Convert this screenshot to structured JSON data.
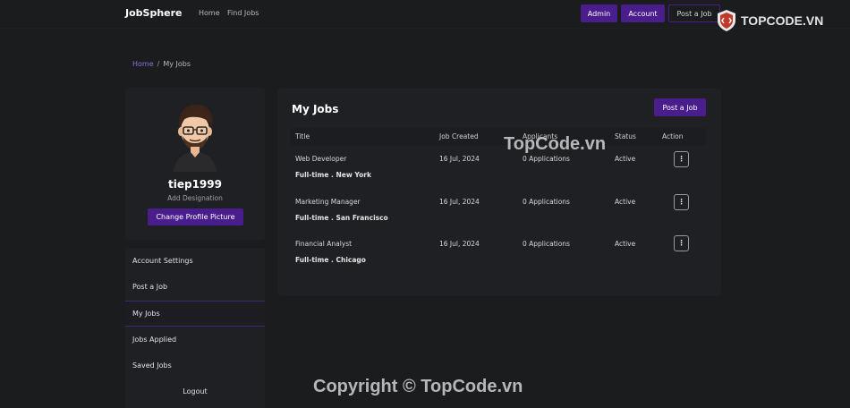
{
  "navbar": {
    "brand": "JobSphere",
    "links": [
      "Home",
      "Find Jobs"
    ],
    "admin_label": "Admin",
    "account_label": "Account",
    "post_job_label": "Post a Job"
  },
  "watermark": {
    "logo_text": "TOPCODE.VN",
    "center_text": "TopCode.vn",
    "bottom_text": "Copyright © TopCode.vn"
  },
  "breadcrumb": {
    "home": "Home",
    "separator": "/",
    "current": "My Jobs"
  },
  "profile": {
    "username": "tiep1999",
    "designation": "Add Designation",
    "change_picture_label": "Change Profile Picture"
  },
  "side_menu": {
    "items": [
      {
        "label": "Account Settings"
      },
      {
        "label": "Post a Job"
      },
      {
        "label": "My Jobs"
      },
      {
        "label": "Jobs Applied"
      },
      {
        "label": "Saved Jobs"
      },
      {
        "label": "Logout"
      }
    ],
    "active": "My Jobs"
  },
  "jobs_panel": {
    "title": "My Jobs",
    "post_job_label": "Post a Job",
    "columns": [
      "Title",
      "Job Created",
      "Applicants",
      "Status",
      "Action"
    ],
    "rows": [
      {
        "title": "Web Developer",
        "meta": "Full-time . New York",
        "created": "16 Jul, 2024",
        "applicants": "0 Applications",
        "status": "Active",
        "action": "⋮"
      },
      {
        "title": "Marketing Manager",
        "meta": "Full-time . San Francisco",
        "created": "16 Jul, 2024",
        "applicants": "0 Applications",
        "status": "Active",
        "action": "⋮"
      },
      {
        "title": "Financial Analyst",
        "meta": "Full-time . Chicago",
        "created": "16 Jul, 2024",
        "applicants": "0 Applications",
        "status": "Active",
        "action": "⋮"
      }
    ]
  },
  "colors": {
    "background": "#1b1c1e",
    "card": "#1f2023",
    "accent": "#4a1d8c",
    "link_accent": "#8b6fe0"
  }
}
